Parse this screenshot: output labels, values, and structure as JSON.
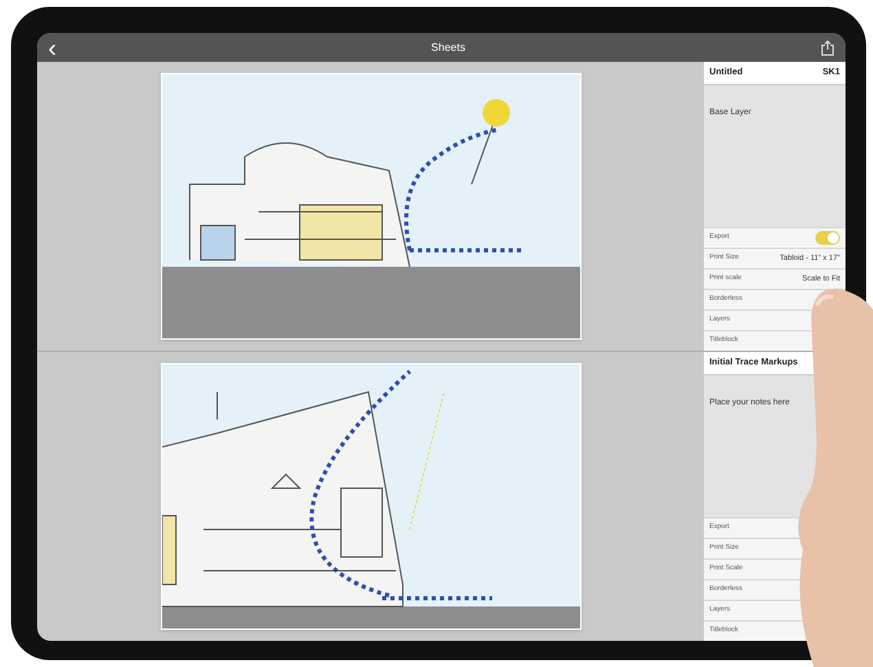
{
  "nav_bar": {
    "back": "‹",
    "title": "Sheets"
  },
  "sheets": [
    {
      "title": "Untitled",
      "code": "SK1",
      "layer": "Base Layer",
      "rows": [
        {
          "kind": "toggle",
          "label": "Export",
          "on": true
        },
        {
          "kind": "value",
          "label": "Print Size",
          "value": "Tabloid - 11\" x 17\""
        },
        {
          "kind": "value",
          "label": "Print scale",
          "value": "Scale to Fit"
        },
        {
          "kind": "plain",
          "label": "Borderless"
        },
        {
          "kind": "plain",
          "label": "Layers"
        },
        {
          "kind": "plain",
          "label": "Titleblock"
        }
      ]
    },
    {
      "title": "Initial Trace Markups",
      "notes": "Place your notes here",
      "rows": [
        {
          "kind": "plain",
          "label": "Export"
        },
        {
          "kind": "plain",
          "label": "Print Size"
        },
        {
          "kind": "plain",
          "label": "Print Scale"
        },
        {
          "kind": "plain",
          "label": "Borderless"
        },
        {
          "kind": "plain",
          "label": "Layers"
        },
        {
          "kind": "plain",
          "label": "Titleblock"
        }
      ]
    }
  ]
}
